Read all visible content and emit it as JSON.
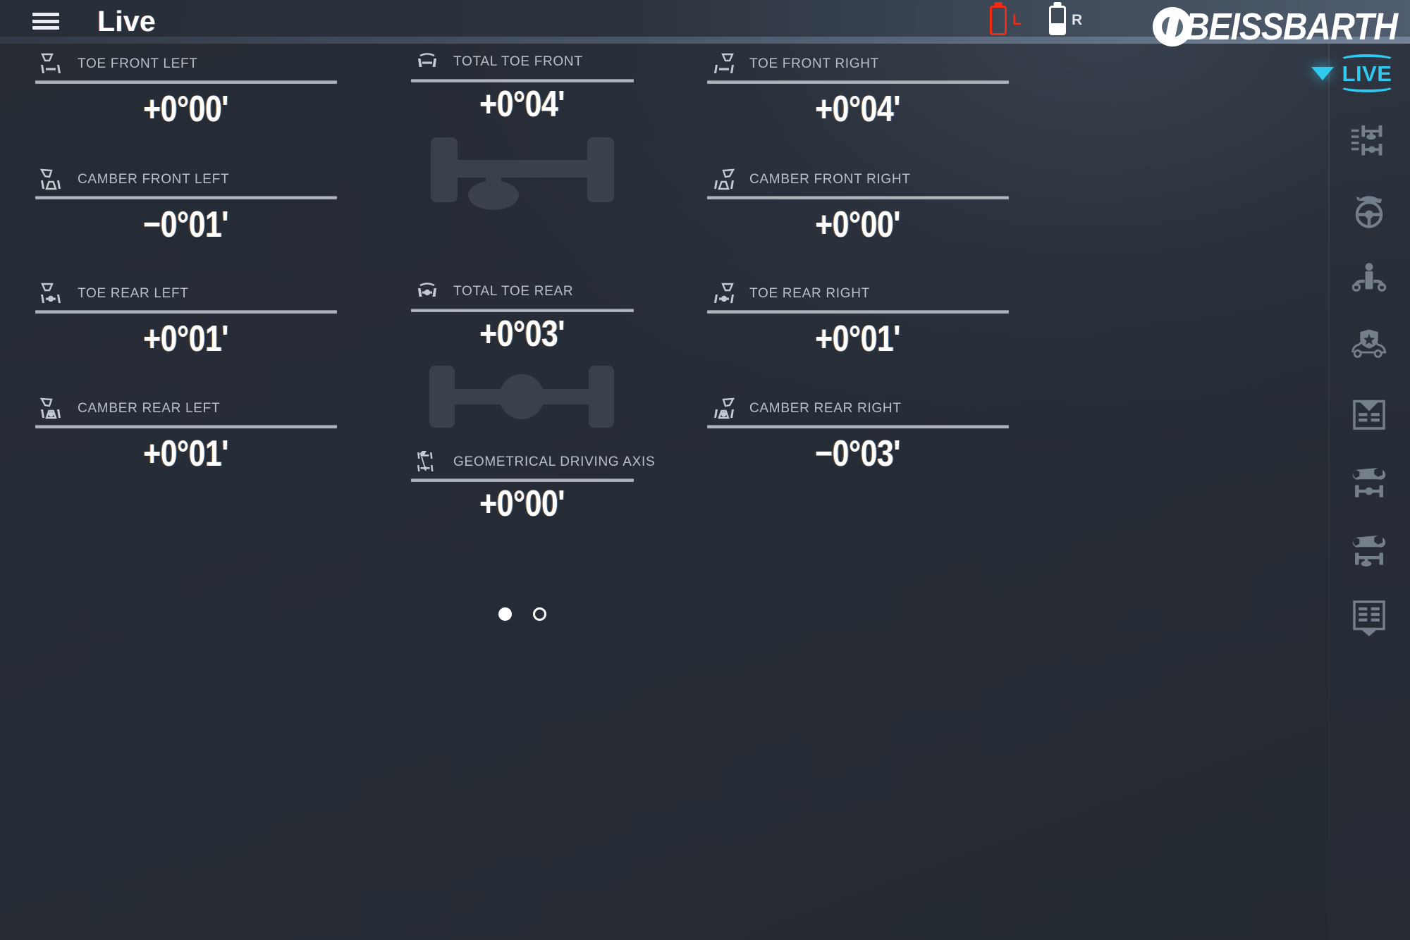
{
  "header": {
    "menu_icon": "hamburger-icon",
    "title": "Live",
    "battery_left": {
      "label": "L",
      "state": "empty",
      "color": "#f42a12",
      "fill_pct": 0
    },
    "battery_right": {
      "label": "R",
      "state": "partial",
      "color": "#ffffff",
      "fill_pct": 40
    },
    "brand": "BEISSBARTH"
  },
  "measurements": {
    "left_column": [
      {
        "icon": "toe-front-left-icon",
        "label": "TOE FRONT LEFT",
        "value": "+0°00'"
      },
      {
        "icon": "camber-front-left-icon",
        "label": "CAMBER FRONT LEFT",
        "value": "−0°01'"
      },
      {
        "icon": "toe-rear-left-icon",
        "label": "TOE REAR LEFT",
        "value": "+0°01'"
      },
      {
        "icon": "camber-rear-left-icon",
        "label": "CAMBER REAR LEFT",
        "value": "+0°01'"
      }
    ],
    "right_column": [
      {
        "icon": "toe-front-right-icon",
        "label": "TOE FRONT RIGHT",
        "value": "+0°04'"
      },
      {
        "icon": "camber-front-right-icon",
        "label": "CAMBER FRONT RIGHT",
        "value": "+0°00'"
      },
      {
        "icon": "toe-rear-right-icon",
        "label": "TOE REAR RIGHT",
        "value": "+0°01'"
      },
      {
        "icon": "camber-rear-right-icon",
        "label": "CAMBER REAR RIGHT",
        "value": "−0°03'"
      }
    ],
    "center_column": [
      {
        "icon": "total-toe-front-icon",
        "label": "TOTAL TOE FRONT",
        "value": "+0°04'",
        "diagram": "front-axle-diagram"
      },
      {
        "icon": "total-toe-rear-icon",
        "label": "TOTAL TOE REAR",
        "value": "+0°03'",
        "diagram": "rear-axle-diagram"
      },
      {
        "icon": "geometrical-driving-axis-icon",
        "label": "GEOMETRICAL DRIVING AXIS",
        "value": "+0°00'"
      }
    ]
  },
  "pagination": {
    "pages": 2,
    "active_index": 0
  },
  "sidebar": {
    "live_button": {
      "label": "LIVE",
      "color": "#2fc9f0",
      "caret": "chevron-down-icon"
    },
    "items": [
      {
        "icon": "axle-measurements-icon",
        "label": "Axle measurements"
      },
      {
        "icon": "steering-wheel-icon",
        "label": "Steering wheel"
      },
      {
        "icon": "vehicle-occupant-icon",
        "label": "Vehicle load"
      },
      {
        "icon": "vehicle-shield-star-icon",
        "label": "Vehicle data"
      },
      {
        "icon": "report-up-icon",
        "label": "Load report"
      },
      {
        "icon": "wrench-rear-axle-icon",
        "label": "Adjust rear axle"
      },
      {
        "icon": "wrench-front-axle-icon",
        "label": "Adjust front axle"
      },
      {
        "icon": "report-down-icon",
        "label": "Save report"
      }
    ]
  },
  "colors": {
    "accent_cyan": "#2fc9f0",
    "battery_low": "#f42a12",
    "value_white": "#ffffff",
    "label_grey": "#b9c0c9",
    "background": "#262b34"
  }
}
